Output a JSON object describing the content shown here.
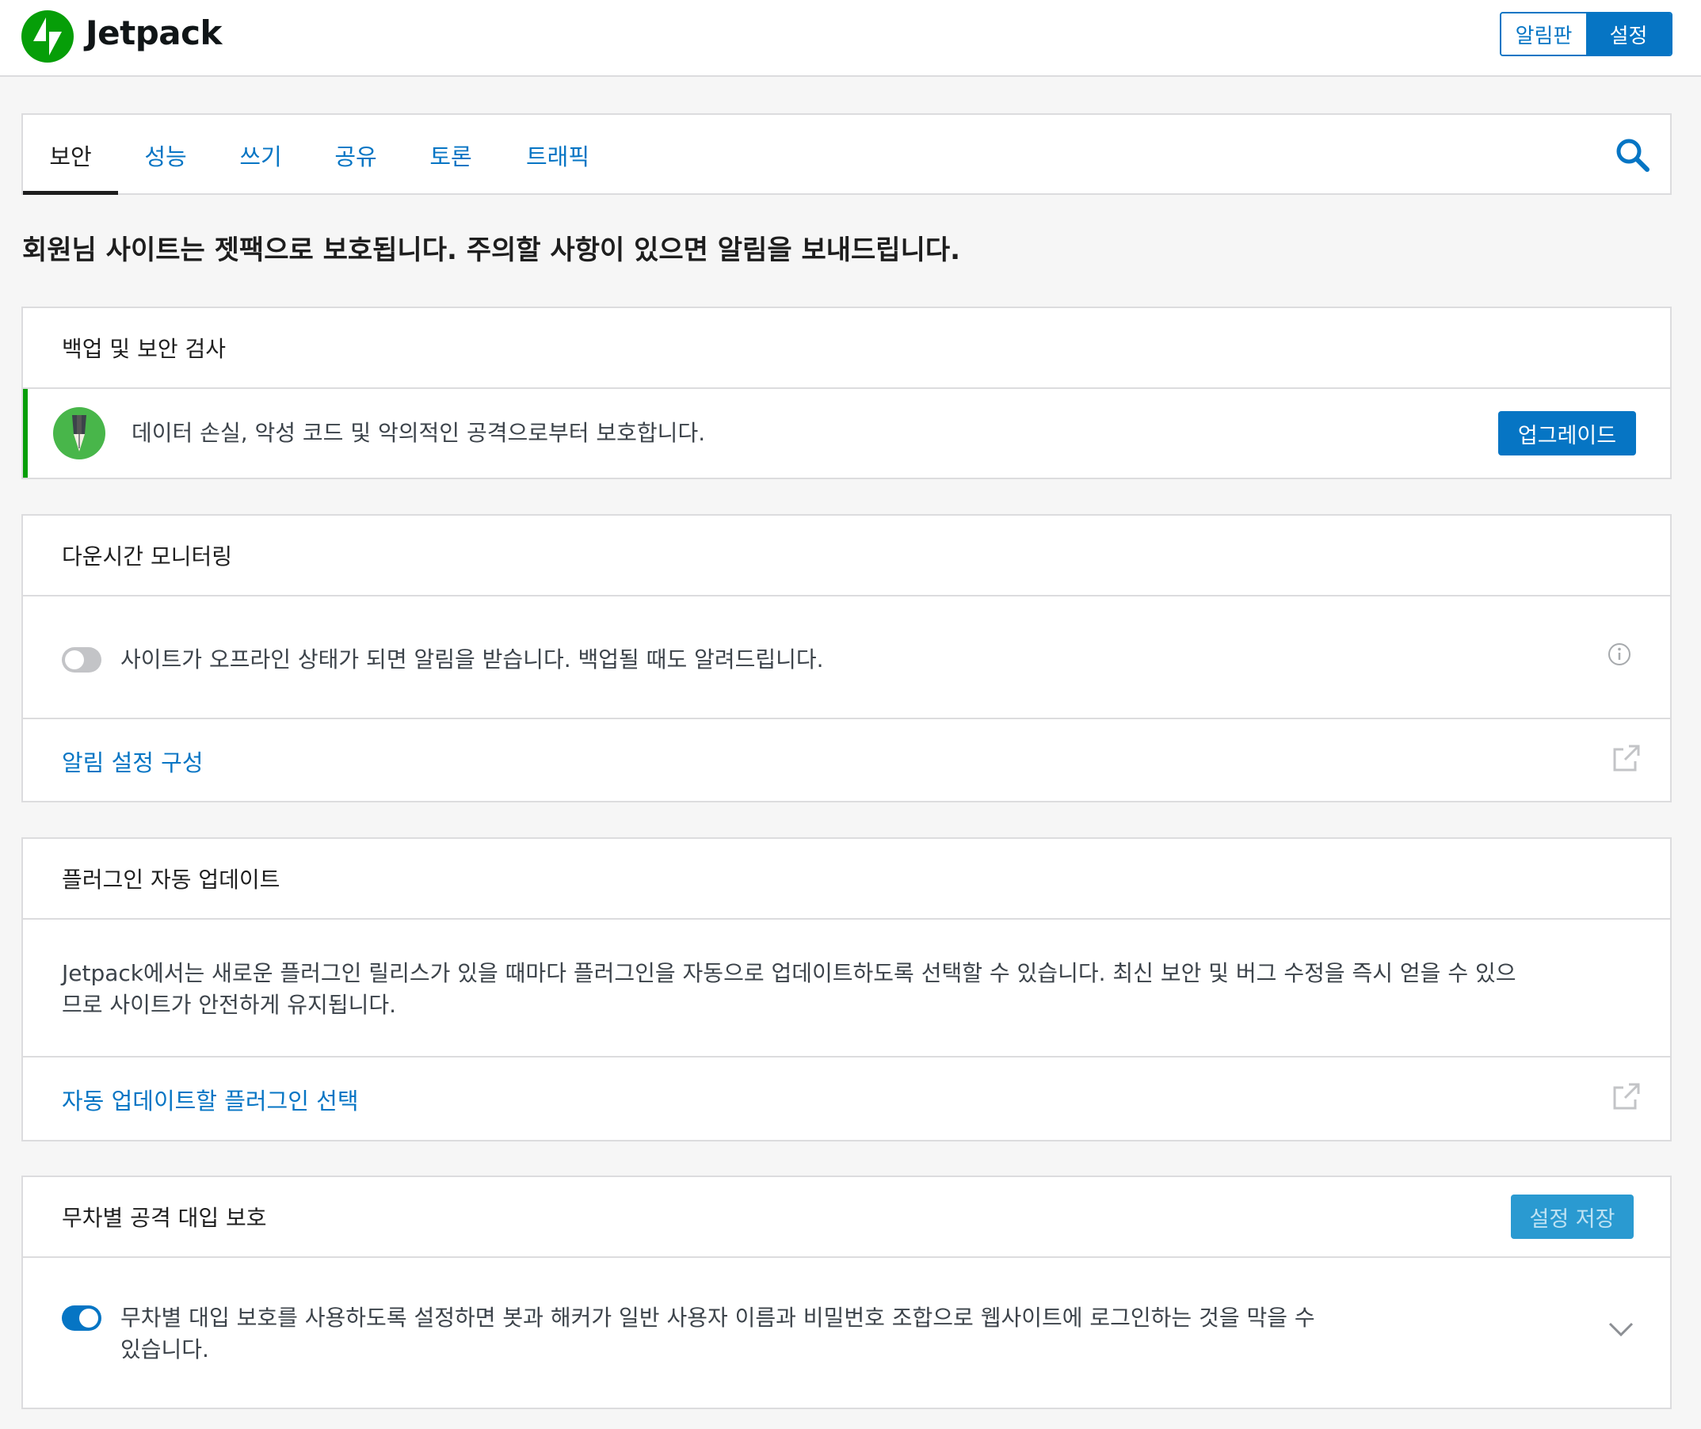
{
  "header": {
    "logo_text": "Jetpack",
    "toggle": {
      "dashboard": "알림판",
      "settings": "설정"
    }
  },
  "tabs": [
    {
      "label": "보안",
      "active": true
    },
    {
      "label": "성능"
    },
    {
      "label": "쓰기"
    },
    {
      "label": "공유"
    },
    {
      "label": "토론"
    },
    {
      "label": "트래픽"
    }
  ],
  "intro": "회원님 사이트는 젯팩으로 보호됩니다. 주의할 사항이 있으면 알림을 보내드립니다.",
  "backup_card": {
    "title": "백업 및 보안 검사",
    "description": "데이터 손실, 악성 코드 및 악의적인 공격으로부터 보호합니다.",
    "button": "업그레이드"
  },
  "downtime_card": {
    "title": "다운시간 모니터링",
    "toggle_label": "사이트가 오프라인 상태가 되면 알림을 받습니다. 백업될 때도 알려드립니다.",
    "toggle_on": false,
    "link": "알림 설정 구성"
  },
  "autoupdate_card": {
    "title": "플러그인 자동 업데이트",
    "description_line1": "Jetpack에서는 새로운 플러그인 릴리스가 있을 때마다 플러그인을 자동으로 업데이트하도록 선택할 수 있습니다. 최신 보안 및 버그 수정을 즉시 얻을 수 있으",
    "description_line2": "므로 사이트가 안전하게 유지됩니다.",
    "link": "자동 업데이트할 플러그인 선택"
  },
  "bruteforce_card": {
    "title": "무차별 공격 대입 보호",
    "save_button": "설정 저장",
    "toggle_label_line1": "무차별 대입 보호를 사용하도록 설정하면 봇과 해커가 일반 사용자 이름과 비밀번호 조합으로 웹사이트에 로그인하는 것을 막을 수",
    "toggle_label_line2": "있습니다.",
    "toggle_on": true
  },
  "colors": {
    "accent": "#0675c4",
    "brand_green": "#069e08",
    "border": "#dcdcde",
    "background": "#f6f6f6"
  }
}
